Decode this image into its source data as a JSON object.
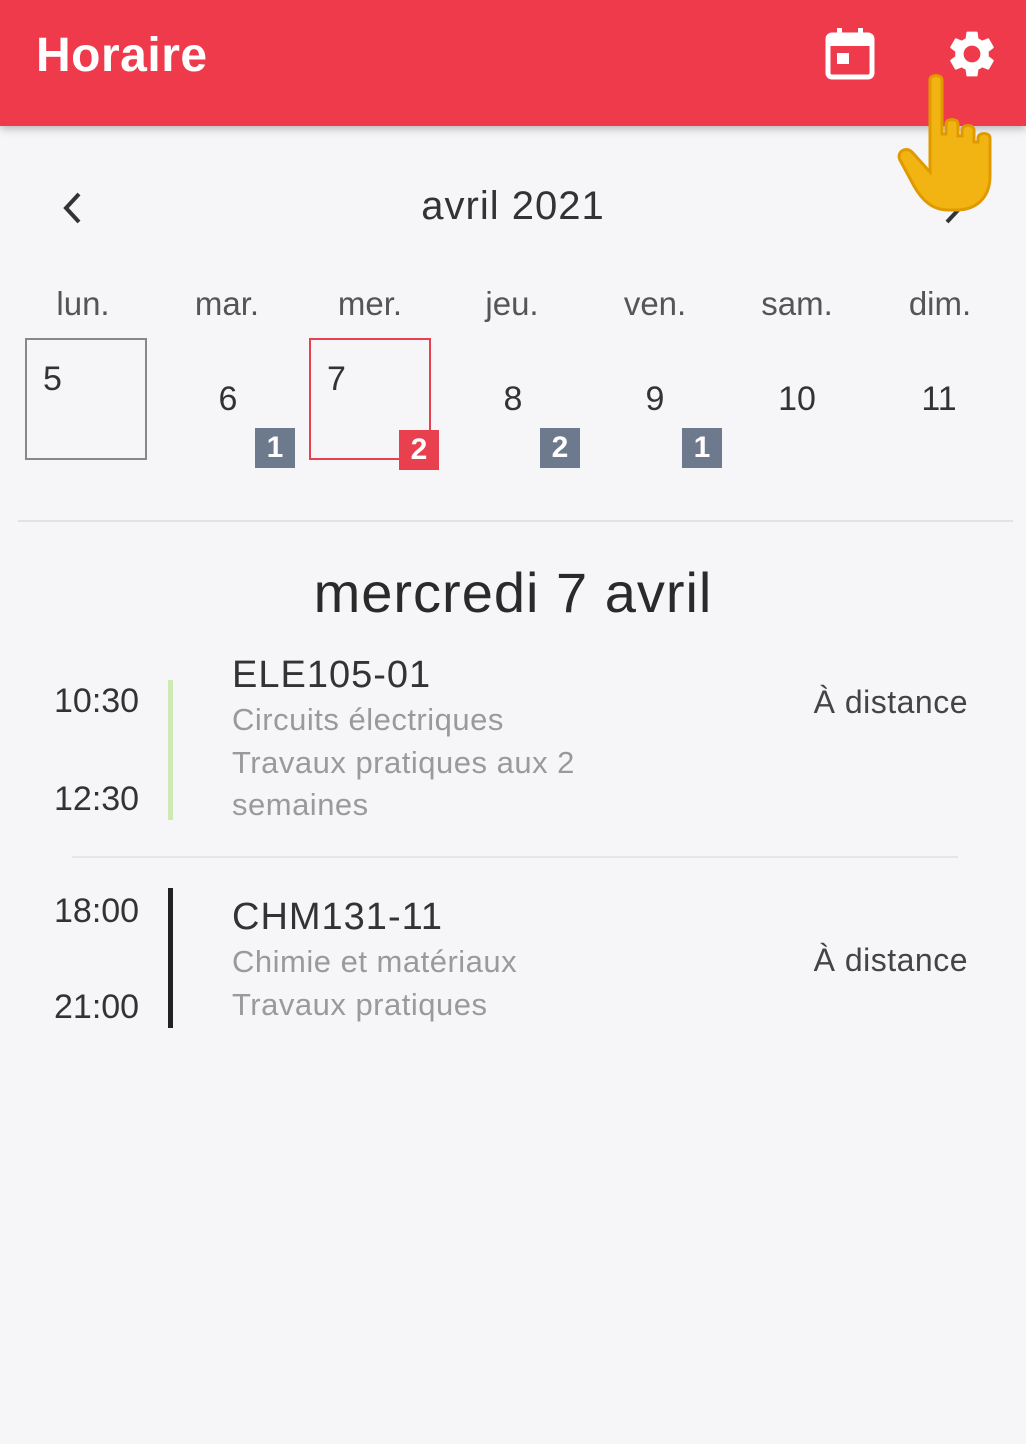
{
  "appbar": {
    "title": "Horaire",
    "color": "#ef3a4c",
    "icons": [
      "calendar-today-icon",
      "gear-icon"
    ]
  },
  "calendar": {
    "month_label": "avril 2021",
    "weekdays": [
      "lun.",
      "mar.",
      "mer.",
      "jeu.",
      "ven.",
      "sam.",
      "dim."
    ],
    "days": [
      {
        "num": "5",
        "badge": "",
        "state": "today"
      },
      {
        "num": "6",
        "badge": "1",
        "state": ""
      },
      {
        "num": "7",
        "badge": "2",
        "state": "selected"
      },
      {
        "num": "8",
        "badge": "2",
        "state": ""
      },
      {
        "num": "9",
        "badge": "1",
        "state": ""
      },
      {
        "num": "10",
        "badge": "",
        "state": ""
      },
      {
        "num": "11",
        "badge": "",
        "state": ""
      }
    ],
    "badge_color": "#6d7a8e",
    "selected_color": "#e8404f"
  },
  "schedule": {
    "date_heading": "mercredi 7 avril",
    "events": [
      {
        "start": "10:30",
        "end": "12:30",
        "code": "ELE105-01",
        "name": "Circuits électriques",
        "type_line1": "Travaux pratiques aux 2",
        "type_line2": "semaines",
        "location": "À distance",
        "bar_color": "#cfe9b4"
      },
      {
        "start": "18:00",
        "end": "21:00",
        "code": "CHM131-11",
        "name": "Chimie et matériaux",
        "type_line1": "Travaux pratiques",
        "location": "À distance",
        "bar_color": "#222222"
      }
    ]
  }
}
